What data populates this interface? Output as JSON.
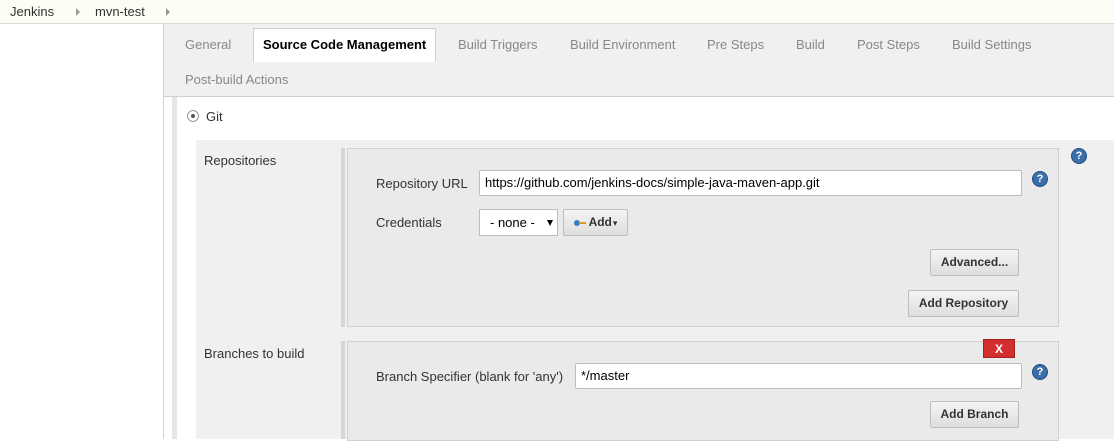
{
  "breadcrumb": {
    "items": [
      "Jenkins",
      "mvn-test"
    ]
  },
  "tabs": [
    {
      "label": "General"
    },
    {
      "label": "Source Code Management"
    },
    {
      "label": "Build Triggers"
    },
    {
      "label": "Build Environment"
    },
    {
      "label": "Pre Steps"
    },
    {
      "label": "Build"
    },
    {
      "label": "Post Steps"
    },
    {
      "label": "Build Settings"
    },
    {
      "label": "Post-build Actions"
    }
  ],
  "active_tab": "Source Code Management",
  "scm": {
    "option_label": "Git",
    "selected": true,
    "repositories": {
      "section_label": "Repositories",
      "url_label": "Repository URL",
      "url_value": "https://github.com/jenkins-docs/simple-java-maven-app.git",
      "credentials_label": "Credentials",
      "credentials_selected": "- none -",
      "add_label": "Add",
      "advanced_label": "Advanced...",
      "add_repository_label": "Add Repository"
    },
    "branches": {
      "section_label": "Branches to build",
      "delete_label": "X",
      "specifier_label": "Branch Specifier (blank for 'any')",
      "specifier_value": "*/master",
      "add_branch_label": "Add Branch"
    },
    "help_glyph": "?"
  },
  "colors": {
    "delete": "#d32f2f",
    "help": "#3c6ea8",
    "tabbar": "#f0f0f0"
  },
  "icons": [
    "help-icon",
    "key-icon",
    "chevron-right-icon",
    "radio-icon"
  ]
}
